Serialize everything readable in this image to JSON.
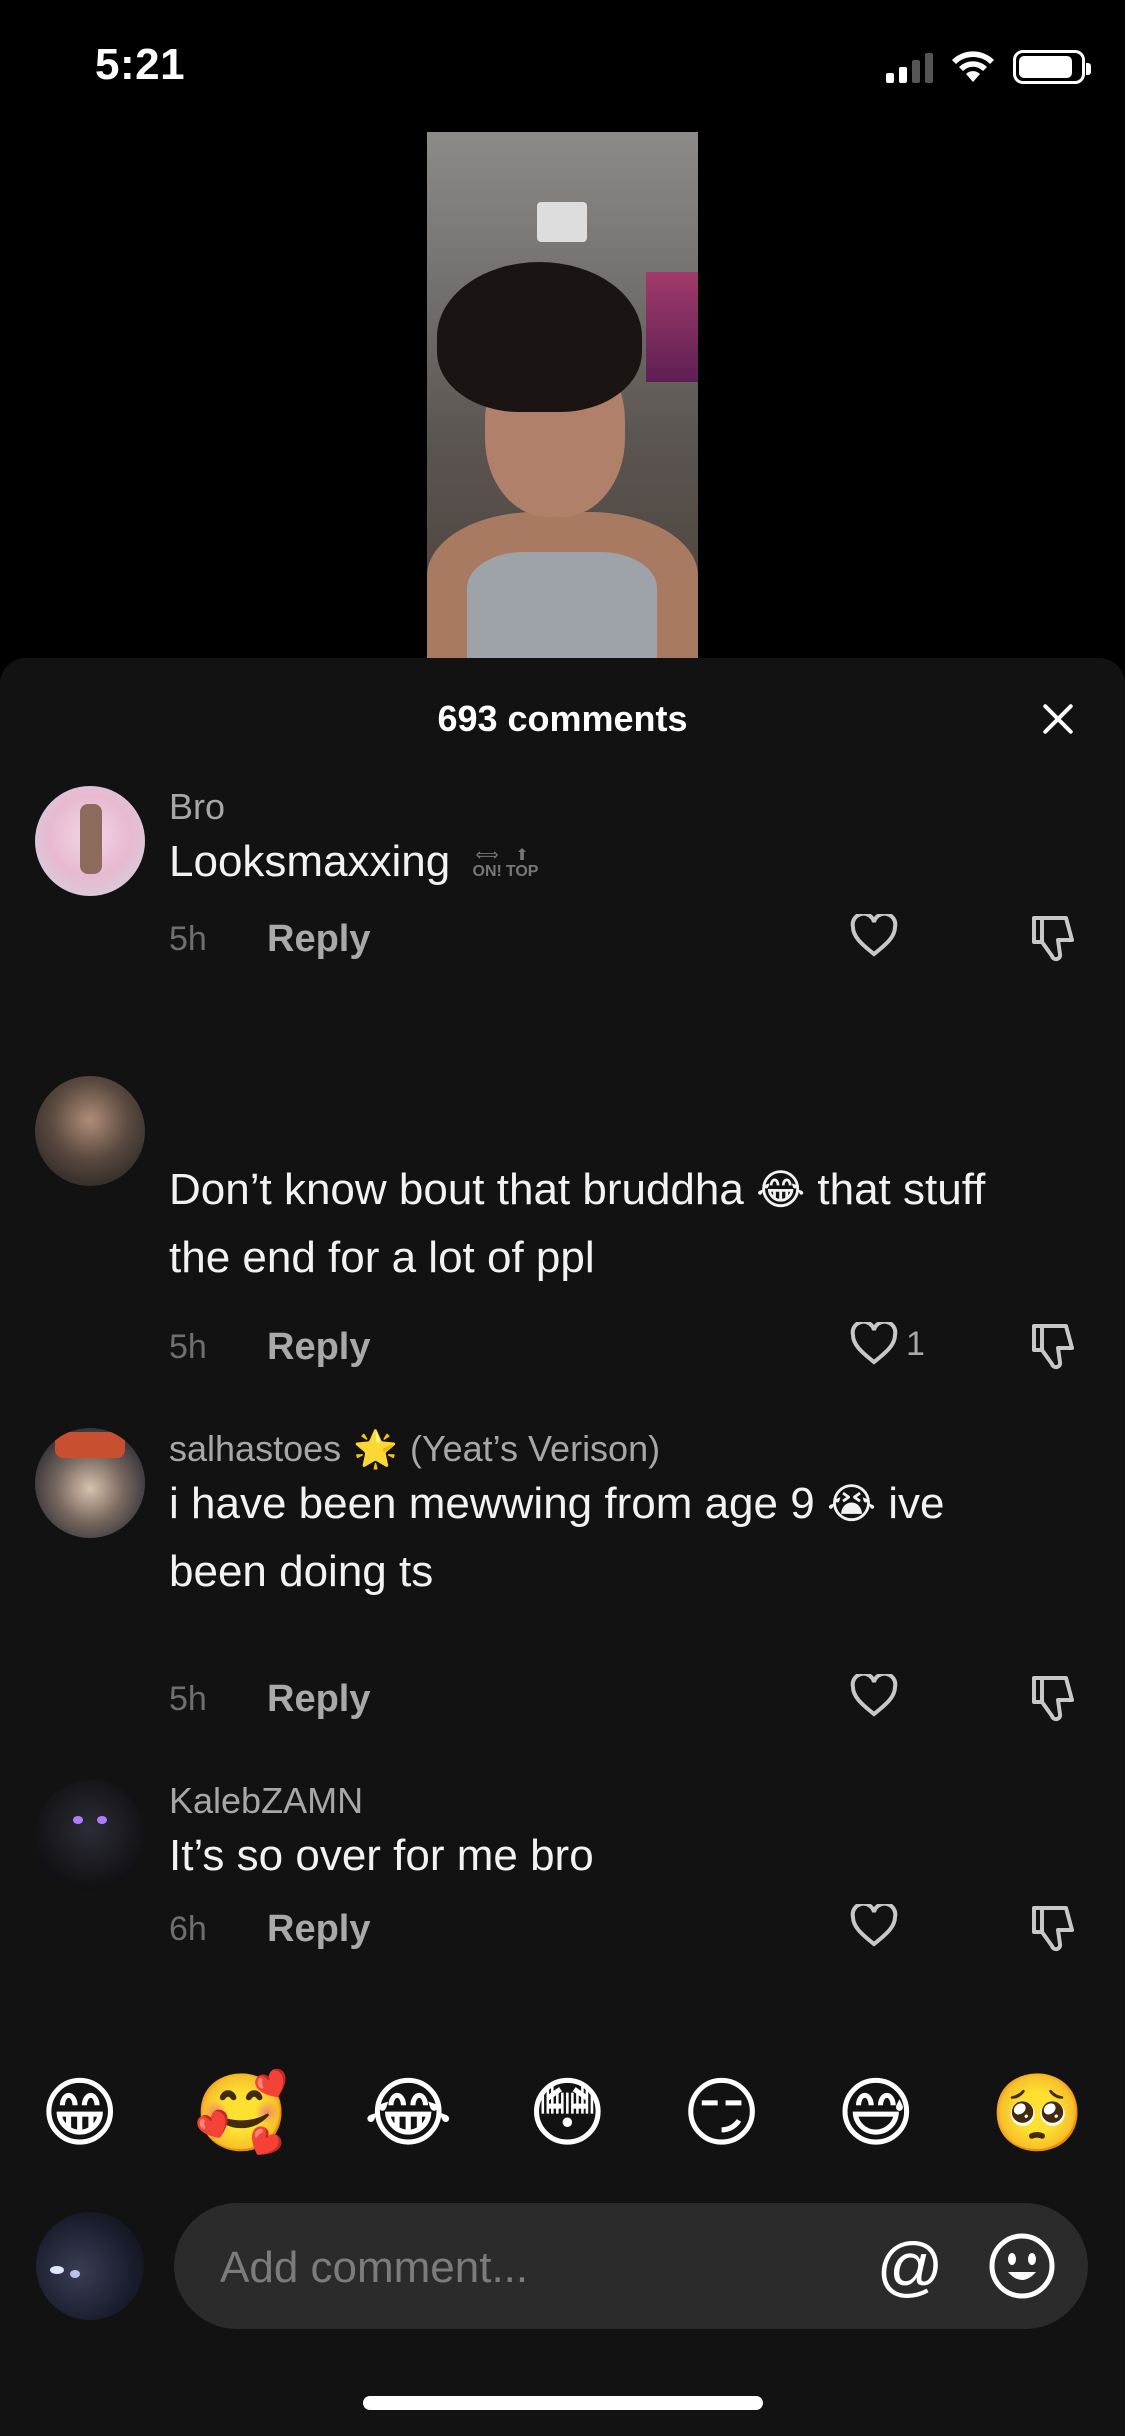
{
  "status_bar": {
    "time": "5:21"
  },
  "sheet": {
    "title": "693 comments"
  },
  "comments": [
    {
      "username": "Bro",
      "text": "Looksmaxxing",
      "badge_left": "ON!",
      "badge_right": "TOP",
      "time": "5h",
      "reply_label": "Reply",
      "likes": ""
    },
    {
      "username": "",
      "text_line1": "Don’t know bout that bruddha",
      "emoji": "😂",
      "text_line1_end": "that stuff",
      "text_line2": "the end for a lot of ppl",
      "time": "5h",
      "reply_label": "Reply",
      "likes": "1"
    },
    {
      "username": "salhastoes",
      "username_emoji": "🌟",
      "username_suffix": "(Yeat’s Verison)",
      "text_line1": "i have been mewwing from age 9",
      "emoji": "😭",
      "text_line1_end": "ive",
      "text_line2": "been doing ts",
      "time": "5h",
      "reply_label": "Reply",
      "likes": ""
    },
    {
      "username": "KalebZAMN",
      "text": "It’s so over for me bro",
      "time": "6h",
      "reply_label": "Reply",
      "likes": ""
    }
  ],
  "emoji_bar": [
    "😁",
    "🥰",
    "😂",
    "😳",
    "😏",
    "😅",
    "🥺"
  ],
  "input": {
    "placeholder": "Add comment...",
    "at_symbol": "@"
  },
  "colors": {
    "sheet_bg": "#121212",
    "input_bg": "#2b2b2b",
    "muted_text": "#a7a7a7"
  }
}
